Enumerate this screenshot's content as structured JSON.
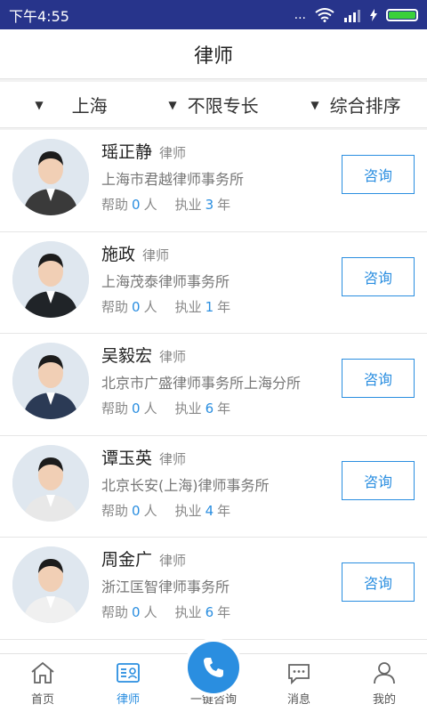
{
  "status_bar": {
    "time": "下午4:55",
    "signal_text": "...",
    "battery_level": 1.0
  },
  "nav": {
    "title": "律师"
  },
  "filters": [
    {
      "label": "上海",
      "arrow_icon": "caret-down-icon"
    },
    {
      "label": "不限专长",
      "arrow_icon": "caret-down-icon"
    },
    {
      "label": "综合排序",
      "arrow_icon": "caret-down-icon"
    }
  ],
  "lawyers": [
    {
      "name": "瑶正静",
      "role": "律师",
      "firm": "上海市君越律师事务所",
      "help_prefix": "帮助",
      "help_count": "0",
      "help_unit": "人",
      "practice_prefix": "执业",
      "practice_years": "3",
      "practice_unit": "年",
      "button": "咨询",
      "avatar_color": "#3a3a3a"
    },
    {
      "name": "施政",
      "role": "律师",
      "firm": "上海茂泰律师事务所",
      "help_prefix": "帮助",
      "help_count": "0",
      "help_unit": "人",
      "practice_prefix": "执业",
      "practice_years": "1",
      "practice_unit": "年",
      "button": "咨询",
      "avatar_color": "#202428"
    },
    {
      "name": "吴毅宏",
      "role": "律师",
      "firm": "北京市广盛律师事务所上海分所",
      "help_prefix": "帮助",
      "help_count": "0",
      "help_unit": "人",
      "practice_prefix": "执业",
      "practice_years": "6",
      "practice_unit": "年",
      "button": "咨询",
      "avatar_color": "#2b3a55"
    },
    {
      "name": "谭玉英",
      "role": "律师",
      "firm": "北京长安(上海)律师事务所",
      "help_prefix": "帮助",
      "help_count": "0",
      "help_unit": "人",
      "practice_prefix": "执业",
      "practice_years": "4",
      "practice_unit": "年",
      "button": "咨询",
      "avatar_color": "#e8e8e8"
    },
    {
      "name": "周金广",
      "role": "律师",
      "firm": "浙江匡智律师事务所",
      "help_prefix": "帮助",
      "help_count": "0",
      "help_unit": "人",
      "practice_prefix": "执业",
      "practice_years": "6",
      "practice_unit": "年",
      "button": "咨询",
      "avatar_color": "#f0f0f0"
    }
  ],
  "tabs": [
    {
      "label": "首页",
      "icon": "home-icon",
      "active": false
    },
    {
      "label": "律师",
      "icon": "lawyer-card-icon",
      "active": true
    },
    {
      "label": "一键咨询",
      "icon": "phone-icon",
      "active": false
    },
    {
      "label": "消息",
      "icon": "chat-bubble-icon",
      "active": false
    },
    {
      "label": "我的",
      "icon": "person-icon",
      "active": false
    }
  ],
  "colors": {
    "accent": "#2a8ee0",
    "status_bar": "#27348b"
  }
}
